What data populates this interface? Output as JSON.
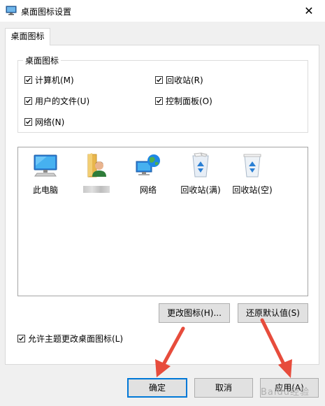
{
  "window": {
    "title": "桌面图标设置",
    "close_glyph": "✕"
  },
  "tab": {
    "label": "桌面图标"
  },
  "group": {
    "legend": "桌面图标",
    "items": [
      {
        "label": "计算机(M)",
        "checked": true
      },
      {
        "label": "回收站(R)",
        "checked": true
      },
      {
        "label": "用户的文件(U)",
        "checked": true
      },
      {
        "label": "控制面板(O)",
        "checked": true
      },
      {
        "label": "网络(N)",
        "checked": true
      }
    ]
  },
  "icons": [
    {
      "label": "此电脑",
      "icon": "computer-icon"
    },
    {
      "label": "",
      "icon": "user-folder-icon"
    },
    {
      "label": "网络",
      "icon": "network-icon"
    },
    {
      "label": "回收站(满)",
      "icon": "recycle-bin-full-icon"
    },
    {
      "label": "回收站(空)",
      "icon": "recycle-bin-empty-icon"
    }
  ],
  "buttons": {
    "change_icon": "更改图标(H)...",
    "restore_default": "还原默认值(S)",
    "ok": "确定",
    "cancel": "取消",
    "apply": "应用(A)"
  },
  "theme_checkbox": {
    "label": "允许主题更改桌面图标(L)",
    "checked": true
  },
  "watermark": "Baidu经验",
  "colors": {
    "accent": "#0078d7",
    "annotation_arrow": "#e74c3c"
  }
}
